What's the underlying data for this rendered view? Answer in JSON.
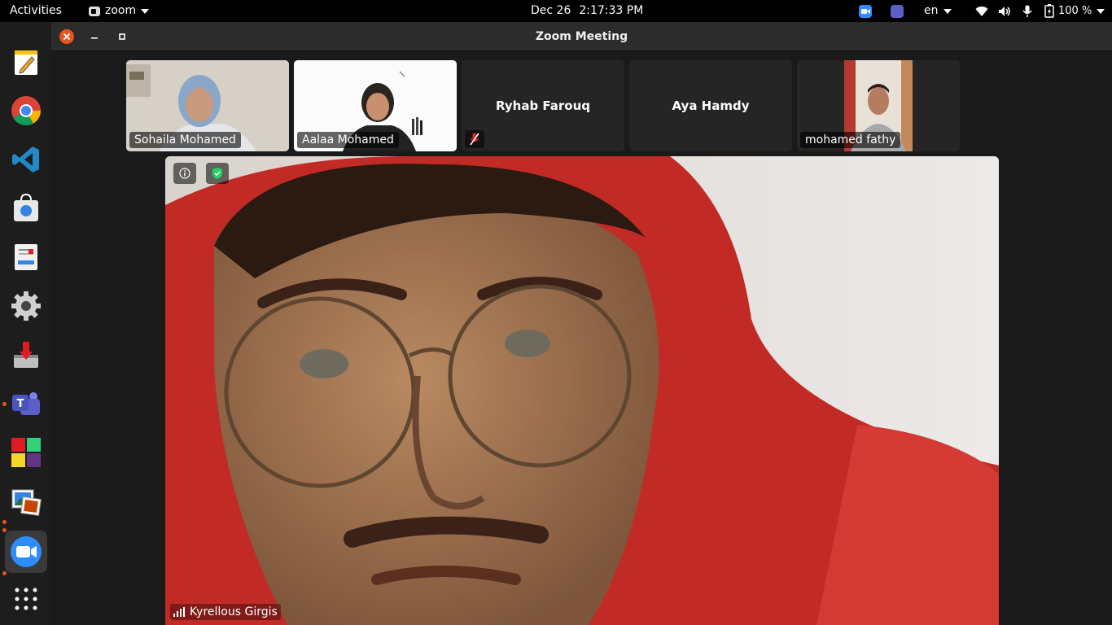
{
  "topbar": {
    "activities": "Activities",
    "app_name": "zoom",
    "date": "Dec 26",
    "time": "2:17:33 PM",
    "language": "en",
    "battery": "100 %"
  },
  "window": {
    "title": "Zoom Meeting"
  },
  "participants": [
    {
      "name": "Sohaila Mohamed",
      "has_video": true
    },
    {
      "name": "Aalaa Mohamed",
      "has_video": true
    },
    {
      "name": "Ryhab Farouq",
      "has_video": false,
      "muted": true
    },
    {
      "name": "Aya Hamdy",
      "has_video": false
    },
    {
      "name": "mohamed fathy",
      "has_video": true
    }
  ],
  "active_speaker": {
    "name": "Kyrellous Girgis"
  },
  "dock": {
    "apps": [
      "text-editor",
      "chrome",
      "vscode",
      "software-store",
      "document-viewer",
      "settings",
      "installer",
      "teams",
      "windows-app",
      "image-viewer",
      "zoom",
      "show-applications"
    ]
  },
  "colors": {
    "accent": "#e95420",
    "zoom_blue": "#2d8cff",
    "shield_green": "#23d160"
  }
}
